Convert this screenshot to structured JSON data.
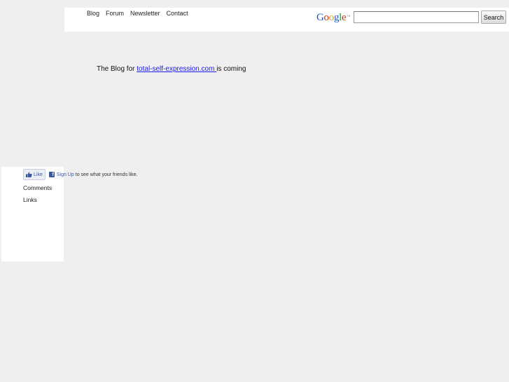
{
  "nav": {
    "items": [
      "Blog",
      "Forum",
      "Newsletter",
      "Contact"
    ]
  },
  "search": {
    "logo_text": "Google",
    "tm": "™",
    "placeholder": "",
    "value": "",
    "button_label": "Search"
  },
  "main": {
    "prefix": "The Blog for ",
    "link_text": "total-self-expression.com ",
    "suffix": "is coming"
  },
  "facebook": {
    "like_label": "Like",
    "f_glyph": "f",
    "signup_label": "Sign Up",
    "signup_suffix": " to see what your friends like."
  },
  "sidebar": {
    "links": [
      "Comments",
      "Links"
    ]
  },
  "colors": {
    "background": "#efefef",
    "facebook_blue": "#3b5998",
    "link_blue": "#1a1aee"
  }
}
